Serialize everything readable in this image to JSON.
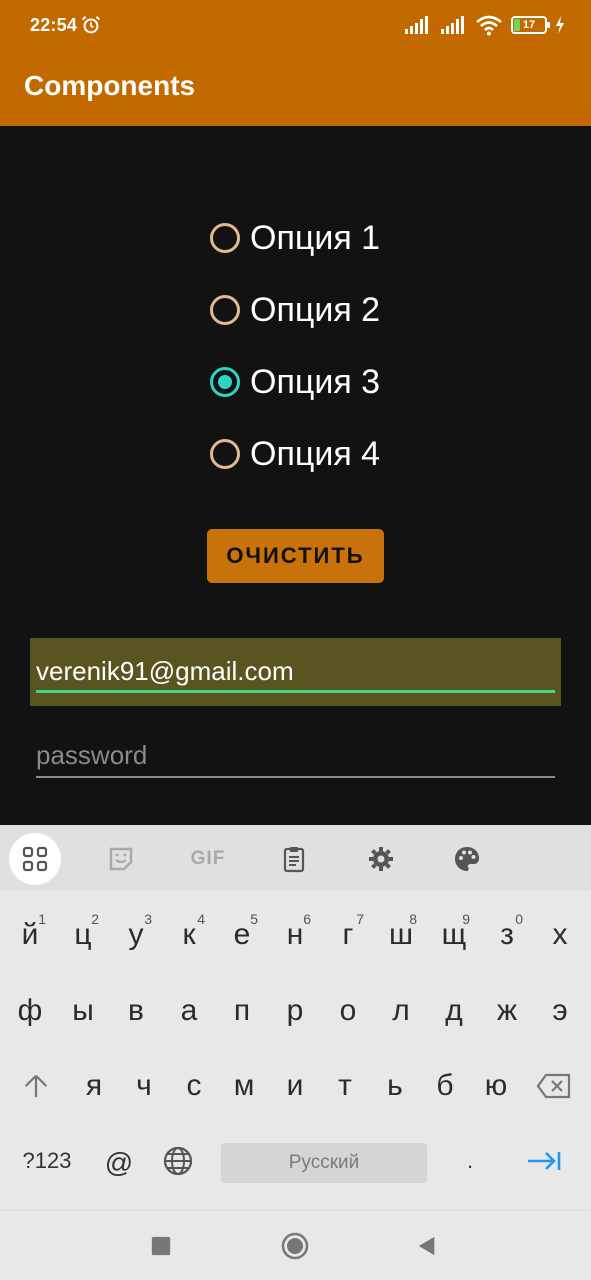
{
  "status_bar": {
    "time": "22:54",
    "battery_level": "17"
  },
  "app_bar": {
    "title": "Components"
  },
  "radio_options": [
    {
      "label": "Опция 1",
      "checked": false
    },
    {
      "label": "Опция 2",
      "checked": false
    },
    {
      "label": "Опция 3",
      "checked": true
    },
    {
      "label": "Опция 4",
      "checked": false
    }
  ],
  "clear_button": {
    "label": "ОЧИСТИТЬ"
  },
  "email_field": {
    "value": "verenik91@gmail.com"
  },
  "password_field": {
    "placeholder": "password"
  },
  "keyboard": {
    "toolbar": [
      "apps-grid-icon",
      "sticker-icon",
      "gif-icon",
      "clipboard-icon",
      "settings-icon",
      "palette-icon"
    ],
    "gif_label": "GIF",
    "row1": [
      {
        "key": "й",
        "hint": "1"
      },
      {
        "key": "ц",
        "hint": "2"
      },
      {
        "key": "у",
        "hint": "3"
      },
      {
        "key": "к",
        "hint": "4"
      },
      {
        "key": "е",
        "hint": "5"
      },
      {
        "key": "н",
        "hint": "6"
      },
      {
        "key": "г",
        "hint": "7"
      },
      {
        "key": "ш",
        "hint": "8"
      },
      {
        "key": "щ",
        "hint": "9"
      },
      {
        "key": "з",
        "hint": "0"
      },
      {
        "key": "х",
        "hint": ""
      }
    ],
    "row2": [
      "ф",
      "ы",
      "в",
      "а",
      "п",
      "р",
      "о",
      "л",
      "д",
      "ж",
      "э"
    ],
    "row3": [
      "я",
      "ч",
      "с",
      "м",
      "и",
      "т",
      "ь",
      "б",
      "ю"
    ],
    "symbols_label": "?123",
    "at_label": "@",
    "space_label": "Русский",
    "period_label": "."
  },
  "colors": {
    "app_bar": "#c26a00",
    "radio_checked": "#2dd4c4",
    "radio_unchecked": "#e3b98f",
    "email_underline": "#3ddc84",
    "enter_key": "#2196f3"
  }
}
